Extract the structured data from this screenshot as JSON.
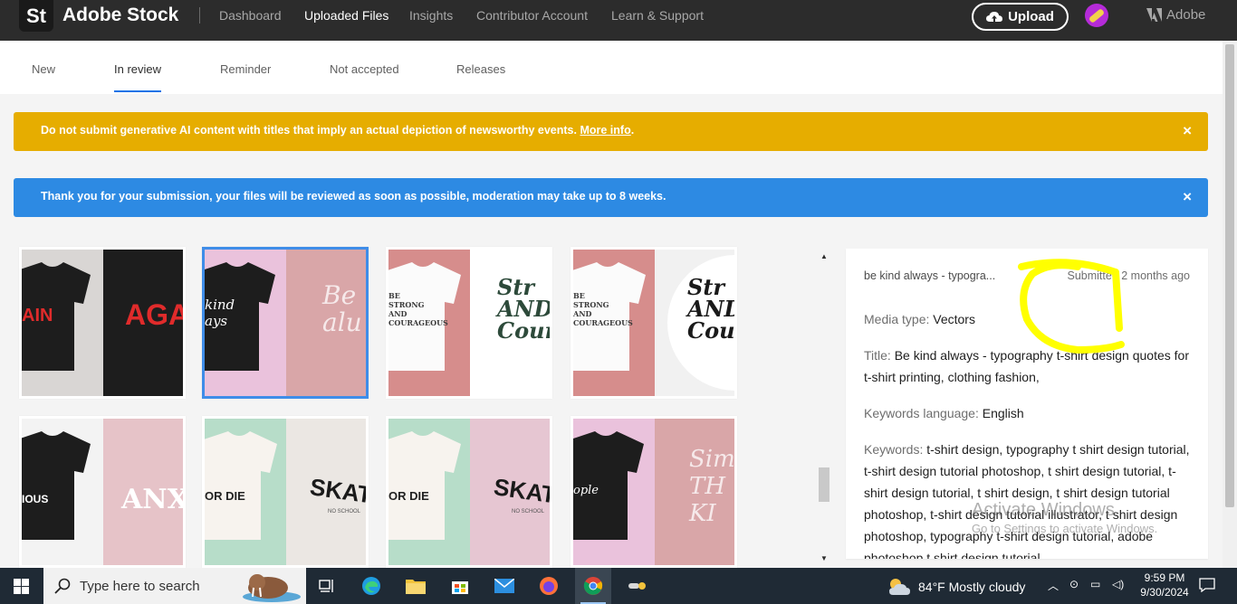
{
  "header": {
    "logo": "St",
    "brand": "Adobe Stock",
    "nav": [
      "Dashboard",
      "Uploaded Files",
      "Insights",
      "Contributor Account",
      "Learn & Support"
    ],
    "upload_label": "Upload",
    "adobe_label": "Adobe"
  },
  "tabs": [
    "New",
    "In review",
    "Reminder",
    "Not accepted",
    "Releases"
  ],
  "banners": {
    "warning": "Do not submit generative AI content with titles that imply an actual depiction of newsworthy events.",
    "warning_link": "More info",
    "warning_tail": ".",
    "info": "Thank you for your submission, your files will be reviewed as soon as possible, moderation may take up to 8 weeks.",
    "close": "×"
  },
  "thumbnails": [
    {
      "left_text": "AIN",
      "right_text": "AGA"
    },
    {
      "left_text": "kind\nays",
      "right_text": "Be\nalu"
    },
    {
      "left_text": "BE\nSTRONG\nAND\nCOURAGEOUS",
      "right_text": "Str\nAND\nCoura"
    },
    {
      "left_text": "BE\nSTRONG\nAND\nCOURAGEOUS",
      "right_text": "Str\nAND\nCoura"
    },
    {
      "left_text": "IOUS",
      "right_text": "ANX"
    },
    {
      "left_text": "OR DIE",
      "right_text": "SKATE",
      "sub": "NO SCHOOL"
    },
    {
      "left_text": "OR DIE",
      "right_text": "SKATE",
      "sub": "NO SCHOOL"
    },
    {
      "left_text": "ople",
      "right_text": "Sim\nTH\nKI"
    }
  ],
  "colors": {
    "header_bg": "#2c2c2c",
    "warning_bg": "#e6ad00",
    "info_bg": "#2d8ae3",
    "selected_border": "#3f8de8",
    "tab_active": "#1473e6",
    "highlight_scribble": "#ffff00"
  },
  "detail": {
    "title": "be kind always - typogra...",
    "submitted": "Submitted 2 months ago",
    "media_type_label": "Media type:",
    "media_type": "Vectors",
    "title_label": "Title:",
    "title_value": "Be kind always - typography t-shirt design quotes for t-shirt printing, clothing fashion,",
    "lang_label": "Keywords language:",
    "lang_value": "English",
    "keywords_label": "Keywords:",
    "keywords_value": "t-shirt design, typography t shirt design tutorial, t-shirt design tutorial photoshop, t shirt design tutorial, t-shirt design tutorial, t shirt design, t shirt design tutorial photoshop, t-shirt design tutorial illustrator, t shirt design photoshop, typography t-shirt design tutorial, adobe photoshop t shirt design tutorial"
  },
  "watermark": {
    "line1": "Activate Windows",
    "line2": "Go to Settings to activate Windows."
  },
  "taskbar": {
    "search_placeholder": "Type here to search",
    "weather": "84°F  Mostly cloudy",
    "time": "9:59 PM",
    "date": "9/30/2024"
  }
}
